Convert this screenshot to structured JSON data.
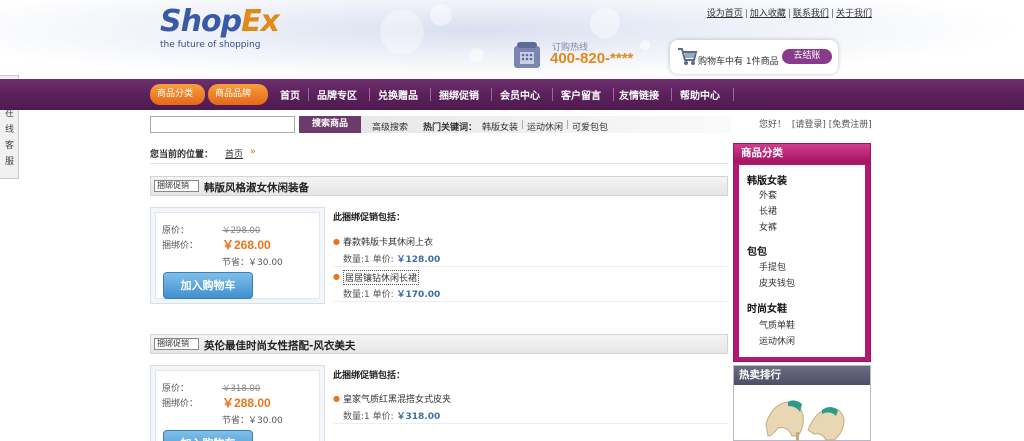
{
  "header": {
    "logo_word_1": "Shop",
    "logo_word_2": "Ex",
    "logo_tagline": "the future of shopping",
    "top_links": [
      "设为首页",
      "加入收藏",
      "联系我们",
      "关于我们"
    ],
    "hotline_label": "订购热线",
    "hotline_number": "400-820-****",
    "cart_text": "购物车中有 1件商品",
    "checkout_label": "去结账"
  },
  "nav": {
    "pill_1": "商品分类",
    "pill_2": "商品品牌",
    "items": [
      "首页",
      "品牌专区",
      "兑换赠品",
      "捆绑促销",
      "会员中心",
      "客户留言",
      "友情链接",
      "帮助中心"
    ]
  },
  "search": {
    "input_value": "",
    "button_label": "搜索商品",
    "advanced_label": "高级搜索",
    "hot_keywords_label": "热门关键词：",
    "keywords": [
      "韩版女装",
      "运动休闲",
      "可爱包包"
    ],
    "greeting": "您好！",
    "login_label": "[请登录]",
    "register_label": "[免费注册]"
  },
  "breadcrumb": {
    "label": "您当前的位置：",
    "home": "首页",
    "arrow": "»"
  },
  "side_tab": {
    "chars": [
      "在",
      "线",
      "客",
      "服"
    ]
  },
  "bundles": [
    {
      "tag": "捆绑促销",
      "name": "韩版风格淑女休闲装备",
      "orig_label": "原价：",
      "orig_price": "￥298.00",
      "bundle_label": "捆绑价：",
      "bundle_price": "￥268.00",
      "save_label": "节省：",
      "save_price": "￥30.00",
      "add_to_cart": "加入购物车",
      "includes_label": "此捆绑促销包括：",
      "items": [
        {
          "name": "春款韩版卡其休闲上衣",
          "qty_label": "数量:1 单价:",
          "price": "￥128.00"
        },
        {
          "name": "居居镶钻休闲长裙",
          "qty_label": "数量:1 单价:",
          "price": "￥170.00"
        }
      ]
    },
    {
      "tag": "捆绑促销",
      "name": "英伦最佳时尚女性搭配-风衣美夫",
      "orig_label": "原价：",
      "orig_price": "￥318.00",
      "bundle_label": "捆绑价：",
      "bundle_price": "￥288.00",
      "save_label": "节省：",
      "save_price": "￥30.00",
      "add_to_cart": "加入购物车",
      "includes_label": "此捆绑促销包括：",
      "items": [
        {
          "name": "皇家气质红黑混搭女式皮夹",
          "qty_label": "数量:1 单价:",
          "price": "￥318.00"
        }
      ]
    }
  ],
  "sidebar": {
    "category_title": "商品分类",
    "groups": [
      {
        "name": "韩版女装",
        "subs": [
          "外套",
          "长裙",
          "女裤"
        ]
      },
      {
        "name": "包包",
        "subs": [
          "手提包",
          "皮夹钱包"
        ]
      },
      {
        "name": "时尚女鞋",
        "subs": [
          "气质单鞋",
          "运动休闲"
        ]
      }
    ],
    "hot_title": "热卖排行"
  },
  "colors": {
    "nav_purple": "#5a205a",
    "accent_orange": "#e9741c",
    "category_magenta": "#b0196f",
    "button_blue": "#3f8fcf",
    "price_blue": "#3a6ea8"
  }
}
